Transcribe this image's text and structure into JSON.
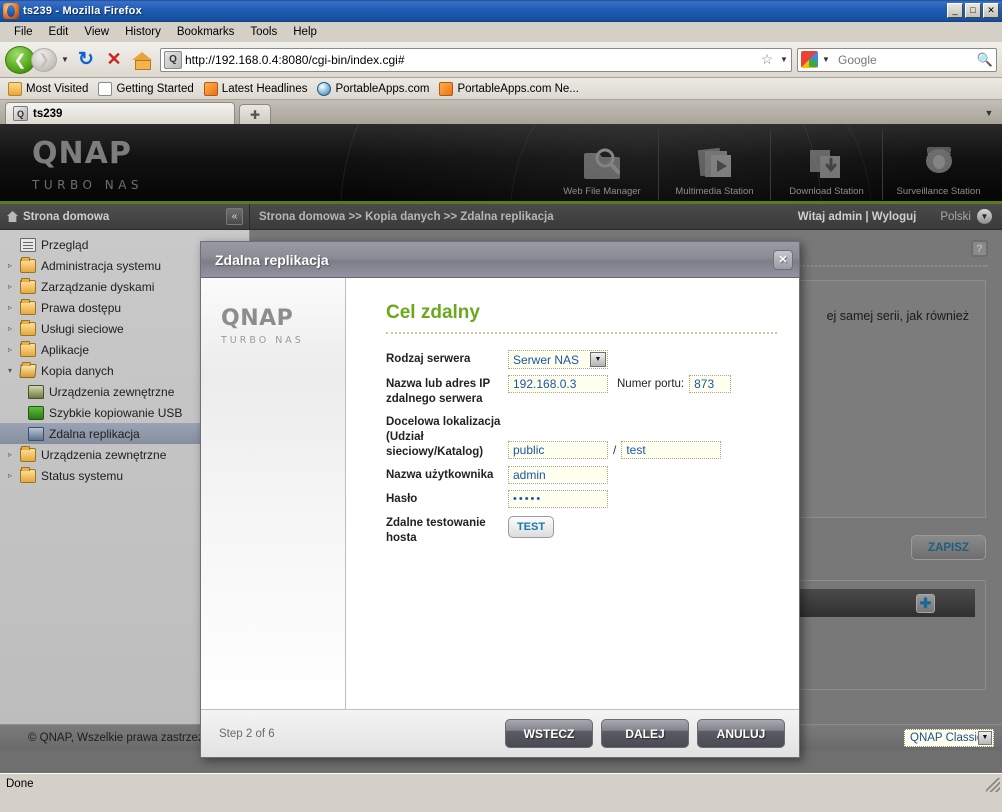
{
  "window": {
    "title": "ts239 - Mozilla Firefox",
    "icon": "firefox-icon",
    "minimize": "_",
    "maximize": "□",
    "close": "✕"
  },
  "menubar": [
    {
      "label": "File"
    },
    {
      "label": "Edit"
    },
    {
      "label": "View"
    },
    {
      "label": "History"
    },
    {
      "label": "Bookmarks"
    },
    {
      "label": "Tools"
    },
    {
      "label": "Help"
    }
  ],
  "toolbar": {
    "back_glyph": "❮",
    "forward_glyph": "❯",
    "dropdown_glyph": "▼",
    "reload_glyph": "↻",
    "stop_glyph": "✕",
    "home_label": "Home",
    "url": "http://192.168.0.4:8080/cgi-bin/index.cgi#",
    "url_favicon_letter": "Q",
    "star_glyph": "☆",
    "star_caret": "▼",
    "search_placeholder": "Google",
    "search_caret": "▼",
    "search_glyph": "🔍"
  },
  "bookmarks": [
    {
      "label": "Most Visited",
      "icon": "folder-icon"
    },
    {
      "label": "Getting Started",
      "icon": "document-icon"
    },
    {
      "label": "Latest Headlines",
      "icon": "rss-icon"
    },
    {
      "label": "PortableApps.com",
      "icon": "globe-icon"
    },
    {
      "label": "PortableApps.com Ne...",
      "icon": "rss-icon"
    }
  ],
  "tabs": {
    "active": {
      "label": "ts239",
      "favicon_letter": "Q"
    },
    "new_tab_glyph": "✚",
    "list_all_glyph": "▼"
  },
  "qnap": {
    "logo_main": "QNAP",
    "logo_sub": "TURBO NAS",
    "stations": [
      {
        "label": "Web File Manager",
        "icon": "web-file-manager-icon"
      },
      {
        "label": "Multimedia Station",
        "icon": "multimedia-station-icon"
      },
      {
        "label": "Download Station",
        "icon": "download-station-icon"
      },
      {
        "label": "Surveillance Station",
        "icon": "surveillance-station-icon"
      }
    ],
    "sidebar_header": "Strona domowa",
    "collapse_glyph": "«",
    "breadcrumb": "Strona domowa >> Kopia danych >> Zdalna replikacja",
    "user_greeting": "Witaj admin | Wyloguj",
    "language": "Polski",
    "language_caret": "▼",
    "help_glyph": "?"
  },
  "sidebar": {
    "items": [
      {
        "label": "Przegląd",
        "icon": "overview-icon",
        "arrow": "",
        "indent": false,
        "selected": false
      },
      {
        "label": "Administracja systemu",
        "icon": "folder-icon",
        "arrow": "▹",
        "indent": false,
        "selected": false
      },
      {
        "label": "Zarządzanie dyskami",
        "icon": "folder-icon",
        "arrow": "▹",
        "indent": false,
        "selected": false
      },
      {
        "label": "Prawa dostępu",
        "icon": "folder-icon",
        "arrow": "▹",
        "indent": false,
        "selected": false
      },
      {
        "label": "Usługi sieciowe",
        "icon": "folder-icon",
        "arrow": "▹",
        "indent": false,
        "selected": false
      },
      {
        "label": "Aplikacje",
        "icon": "folder-icon",
        "arrow": "▹",
        "indent": false,
        "selected": false
      },
      {
        "label": "Kopia danych",
        "icon": "folder-open-icon",
        "arrow": "▾",
        "indent": false,
        "selected": false
      },
      {
        "label": "Urządzenia zewnętrzne",
        "icon": "device-icon",
        "arrow": "",
        "indent": true,
        "selected": false
      },
      {
        "label": "Szybkie kopiowanie USB",
        "icon": "usb-icon",
        "arrow": "",
        "indent": true,
        "selected": false
      },
      {
        "label": "Zdalna replikacja",
        "icon": "replication-icon",
        "arrow": "",
        "indent": true,
        "selected": true
      },
      {
        "label": "Urządzenia zewnętrzne",
        "icon": "folder-icon",
        "arrow": "▹",
        "indent": false,
        "selected": false
      },
      {
        "label": "Status systemu",
        "icon": "folder-icon",
        "arrow": "▹",
        "indent": false,
        "selected": false
      }
    ]
  },
  "background_page": {
    "panel_text": "ej samej serii, jak również",
    "save_label": "ZAPISZ",
    "add_glyph": "✚",
    "footer_copyright": "© QNAP, Wszelkie prawa zastrzeżone",
    "theme_value": "QNAP Classic",
    "theme_caret": "▼"
  },
  "dialog": {
    "title": "Zdalna replikacja",
    "close_glyph": "✕",
    "logo_main": "QNAP",
    "logo_sub": "TURBO NAS",
    "heading": "Cel zdalny",
    "fields": {
      "server_type": {
        "label": "Rodzaj serwera",
        "value": "Serwer NAS",
        "caret": "▼"
      },
      "host": {
        "label": "Nazwa lub adres IP zdalnego serwera",
        "value": "192.168.0.3"
      },
      "port": {
        "label": "Numer portu:",
        "value": "873"
      },
      "destination": {
        "label": "Docelowa lokalizacja (Udział sieciowy/Katalog)",
        "share": "public",
        "separator": "/",
        "folder": "test"
      },
      "username": {
        "label": "Nazwa użytkownika",
        "value": "admin"
      },
      "password": {
        "label": "Hasło",
        "value": "•••••"
      },
      "test_host": {
        "label": "Zdalne testowanie hosta",
        "button": "TEST"
      }
    },
    "step_text": "Step 2 of 6",
    "buttons": {
      "back": "WSTECZ",
      "next": "DALEJ",
      "cancel": "ANULUJ"
    }
  },
  "statusbar": {
    "text": "Done"
  }
}
